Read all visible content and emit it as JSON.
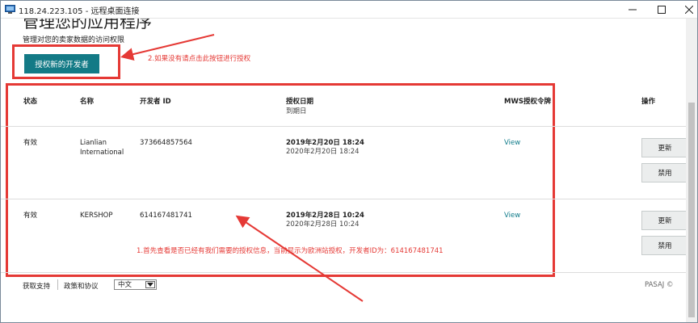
{
  "window": {
    "title": "118.24.223.105 - 远程桌面连接"
  },
  "page": {
    "title": "管理您的应用程序",
    "description": "管理对您的卖家数据的访问权限",
    "auth_button": "授权新的开发者"
  },
  "annotations": {
    "step2": "2.如果没有请点击此按钮进行授权",
    "step1": "1.首先查看是否已经有我们需要的授权信息，当前显示为欧洲站授权，开发者ID为：614167481741"
  },
  "table": {
    "headers": {
      "status": "状态",
      "name": "名称",
      "developer_id": "开发者 ID",
      "auth_date": "授权日期",
      "expiry": "到期日",
      "mws_token": "MWS授权令牌",
      "actions": "操作"
    },
    "rows": [
      {
        "status": "有效",
        "name": "Lianlian International",
        "developer_id": "373664857564",
        "auth_date": "2019年2月20日 18:24",
        "expiry": "2020年2月20日 18:24",
        "token_link": "View",
        "update_label": "更新",
        "disable_label": "禁用"
      },
      {
        "status": "有效",
        "name": "KERSHOP",
        "developer_id": "614167481741",
        "auth_date": "2019年2月28日 10:24",
        "expiry": "2020年2月28日 10:24",
        "token_link": "View",
        "update_label": "更新",
        "disable_label": "禁用"
      }
    ]
  },
  "footer": {
    "support": "获取支持",
    "policy": "政策和协议",
    "language": "中文",
    "right_text": "PASAJ  © "
  },
  "colors": {
    "accent": "#137a86",
    "annotation": "#e53935",
    "link": "#0f7b8a"
  },
  "icons": {
    "app": "remote-desktop-icon",
    "minimize": "minimize-icon",
    "maximize": "maximize-icon",
    "close": "close-icon"
  }
}
